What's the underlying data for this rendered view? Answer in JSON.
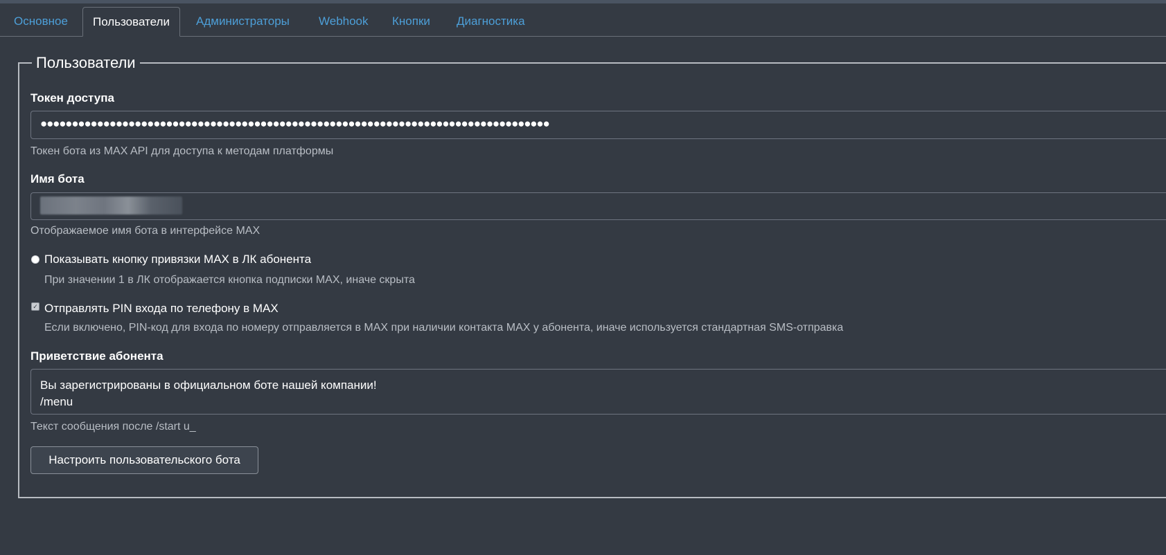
{
  "tabs": [
    {
      "label": "Основное",
      "active": false
    },
    {
      "label": "Пользователи",
      "active": true
    },
    {
      "label": "Администраторы",
      "active": false
    },
    {
      "label": "Webhook",
      "active": false
    },
    {
      "label": "Кнопки",
      "active": false
    },
    {
      "label": "Диагностика",
      "active": false
    }
  ],
  "section": {
    "legend": "Пользователи"
  },
  "token": {
    "label": "Токен доступа",
    "value_masked": "●●●●●●●●●●●●●●●●●●●●●●●●●●●●●●●●●●●●●●●●●●●●●●●●●●●●●●●●●●●●●●●●●●●●●●●●●●●●●●●●●",
    "help": "Токен бота из MAX API для доступа к методам платформы"
  },
  "bot_name": {
    "label": "Имя бота",
    "help": "Отображаемое имя бота в интерфейсе MAX"
  },
  "show_link_button": {
    "label": "Показывать кнопку привязки MAX в ЛК абонента",
    "help": "При значении 1 в ЛК отображается кнопка подписки MAX, иначе скрыта",
    "checked": true
  },
  "send_pin": {
    "label": "Отправлять PIN входа по телефону в MAX",
    "help": "Если включено, PIN-код для входа по номеру отправляется в MAX при наличии контакта MAX у абонента, иначе используется стандартная SMS-отправка",
    "checked": true
  },
  "greeting": {
    "label": "Приветствие абонента",
    "line1": "Вы зарегистрированы в официальном боте нашей компании!",
    "line2": "/menu",
    "help": "Текст сообщения после /start u_"
  },
  "setup_button": {
    "label": "Настроить пользовательского бота"
  },
  "colors": {
    "background": "#343a43",
    "link": "#4d9fd8",
    "help_text": "#b9bec5",
    "border": "#6e7480"
  }
}
